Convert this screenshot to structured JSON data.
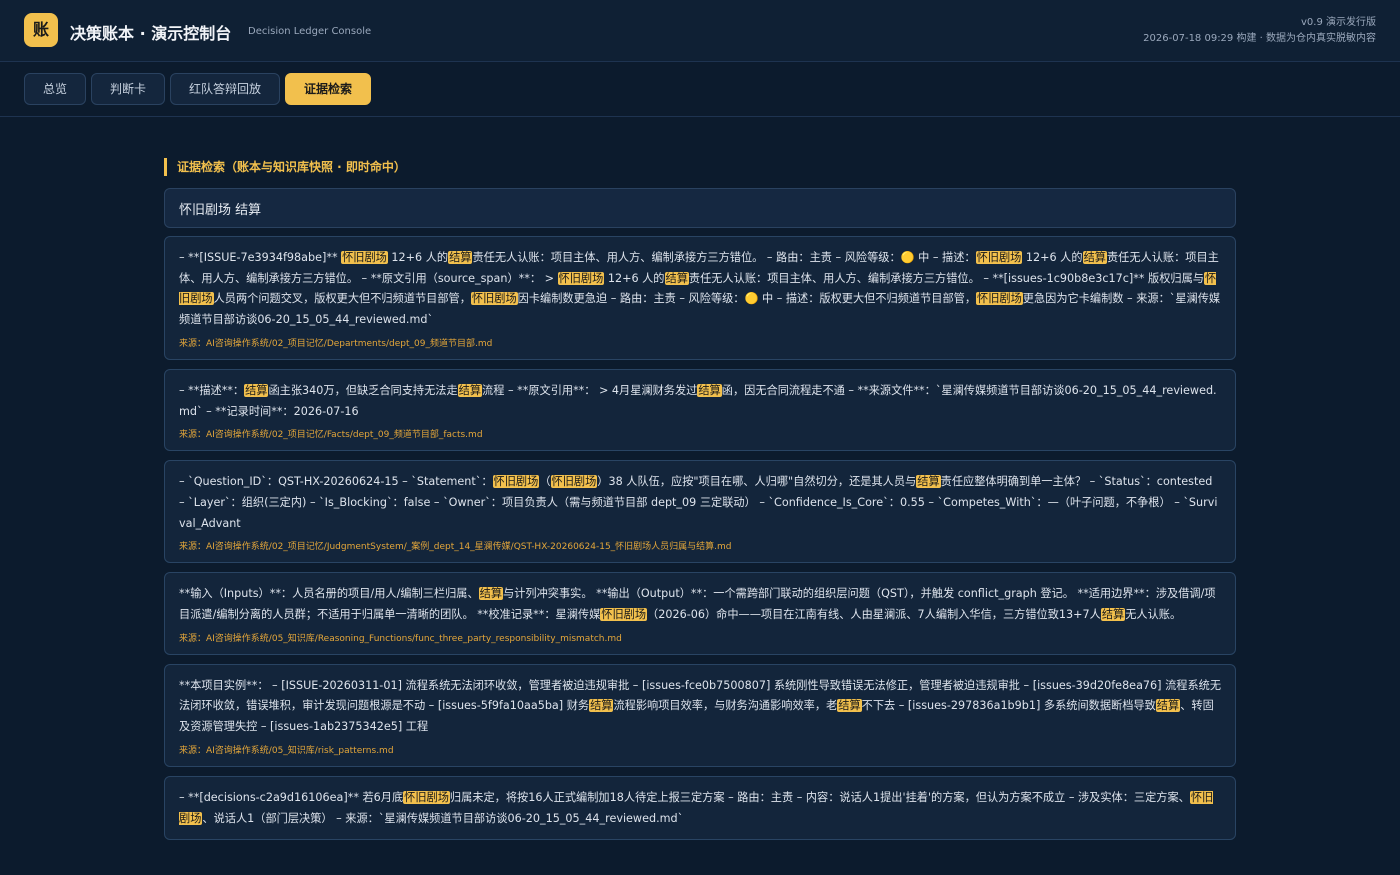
{
  "header": {
    "logo_char": "账",
    "title": "决策账本 · 演示控制台",
    "subtitle": "Decision Ledger Console",
    "version": "v0.9 演示发行版",
    "build_info": "2026-07-18 09:29 构建 · 数据为仓内真实脱敏内容"
  },
  "tabs": [
    {
      "label": "总览",
      "active": false
    },
    {
      "label": "判断卡",
      "active": false
    },
    {
      "label": "红队答辩回放",
      "active": false
    },
    {
      "label": "证据检索",
      "active": true
    }
  ],
  "section_title": "证据检索（账本与知识库快照 · 即时命中）",
  "search": {
    "value": "怀旧剧场 结算"
  },
  "colors": {
    "accent": "#f2c04d",
    "background": "#0c1b2d",
    "card": "#13253b",
    "source": "#e3a63a"
  },
  "results": [
    {
      "text": "– **[ISSUE-7e3934f98abe]** [[怀旧剧场]] 12+6 人的[[结算]]责任无人认账：项目主体、用人方、编制承接方三方错位。 – 路由：主责 – 风险等级：🟡 中 – 描述：[[怀旧剧场]] 12+6 人的[[结算]]责任无人认账：项目主体、用人方、编制承接方三方错位。 – **原文引用（source_span）**： > [[怀旧剧场]] 12+6 人的[[结算]]责任无人认账：项目主体、用人方、编制承接方三方错位。 – **[issues-1c90b8e3c17c]** 版权归属与[[怀旧剧场]]人员两个问题交叉，版权更大但不归频道节目部管，[[怀旧剧场]]因卡编制数更急迫 – 路由：主责 – 风险等级：🟡 中 – 描述：版权更大但不归频道节目部管，[[怀旧剧场]]更急因为它卡编制数 – 来源：`星澜传媒频道节目部访谈06-20_15_05_44_reviewed.md`",
      "source": "来源：AI咨询操作系统/02_项目记忆/Departments/dept_09_频道节目部.md"
    },
    {
      "text": "– **描述**：[[结算]]函主张340万，但缺乏合同支持无法走[[结算]]流程 – **原文引用**： > 4月星澜财务发过[[结算]]函，因无合同流程走不通 – **来源文件**：`星澜传媒频道节目部访谈06-20_15_05_44_reviewed.md` – **记录时间**：2026-07-16",
      "source": "来源：AI咨询操作系统/02_项目记忆/Facts/dept_09_频道节目部_facts.md"
    },
    {
      "text": "– `Question_ID`：QST-HX-20260624-15 – `Statement`：[[怀旧剧场]]（[[怀旧剧场]]）38 人队伍，应按\"项目在哪、人归哪\"自然切分，还是其人员与[[结算]]责任应整体明确到单一主体？ – `Status`：contested – `Layer`：组织(三定内) – `Is_Blocking`：false – `Owner`：项目负责人（需与频道节目部 dept_09 三定联动） – `Confidence_Is_Core`：0.55 – `Competes_With`：—（叶子问题，不争根） – `Survival_Advant",
      "source": "来源：AI咨询操作系统/02_项目记忆/JudgmentSystem/_案例_dept_14_星澜传媒/QST-HX-20260624-15_怀旧剧场人员归属与结算.md"
    },
    {
      "text": "**输入（Inputs）**：人员名册的项目/用人/编制三栏归属、[[结算]]与计列冲突事实。 **输出（Output）**：一个需跨部门联动的组织层问题（QST），并触发 conflict_graph 登记。 **适用边界**：涉及借调/项目派遣/编制分离的人员群；不适用于归属单一清晰的团队。 **校准记录**：星澜传媒[[怀旧剧场]]（2026-06）命中——项目在江南有线、人由星澜派、7人编制入华信，三方错位致13+7人[[结算]]无人认账。",
      "source": "来源：AI咨询操作系统/05_知识库/Reasoning_Functions/func_three_party_responsibility_mismatch.md"
    },
    {
      "text": "**本项目实例**： – [ISSUE-20260311-01] 流程系统无法闭环收敛，管理者被迫违规审批 – [issues-fce0b7500807] 系统刚性导致错误无法修正，管理者被迫违规审批 – [issues-39d20fe8ea76] 流程系统无法闭环收敛，错误堆积，审计发现问题根源是不动 – [issues-5f9fa10aa5ba] 财务[[结算]]流程影响项目效率，与财务沟通影响效率，老[[结算]]不下去 – [issues-297836a1b9b1] 多系统间数据断档导致[[结算]]、转固及资源管理失控 – [issues-1ab2375342e5] 工程",
      "source": "来源：AI咨询操作系统/05_知识库/risk_patterns.md"
    },
    {
      "text": "– **[decisions-c2a9d16106ea]** 若6月底[[怀旧剧场]]归属未定，将按16人正式编制加18人待定上报三定方案 – 路由：主责 – 内容：说话人1提出'挂着'的方案，但认为方案不成立 – 涉及实体：三定方案、[[怀旧剧场]]、说话人1（部门层决策） – 来源：`星澜传媒频道节目部访谈06-20_15_05_44_reviewed.md`",
      "source": ""
    }
  ]
}
